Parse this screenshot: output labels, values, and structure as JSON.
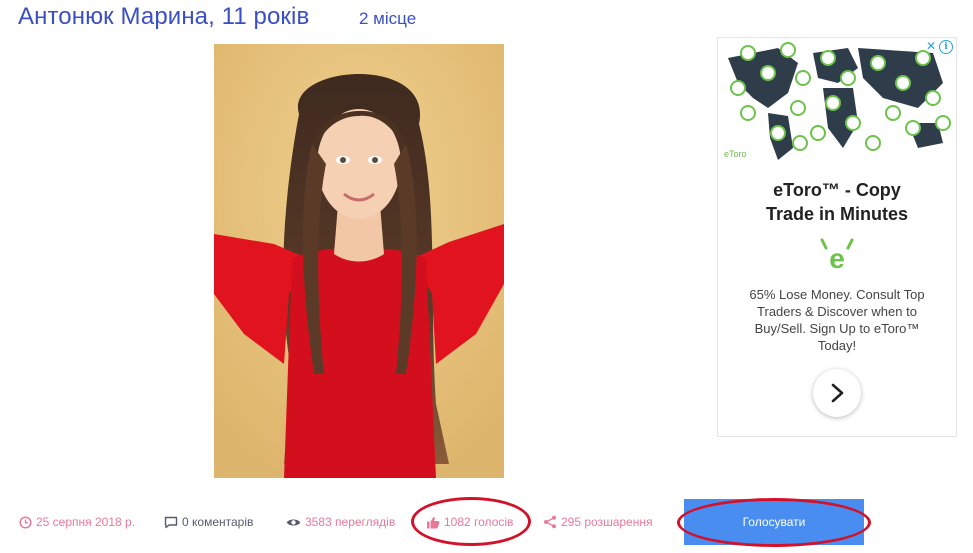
{
  "header": {
    "title": "Антонюк Марина, 11 років",
    "place": "2 місце"
  },
  "photo": {
    "subject": "girl-portrait-red-dress"
  },
  "ad": {
    "headline_line1": "eToro™ - Copy",
    "headline_line2": "Trade in Minutes",
    "body_line1": "65% Lose Money. Consult Top",
    "body_line2": "Traders & Discover when to",
    "body_line3": "Buy/Sell. Sign Up to eToro™",
    "body_line4": "Today!",
    "map_logo_text": "eToro",
    "brand_color": "#6cc24a"
  },
  "meta": {
    "date": "25 серпня 2018 р.",
    "comments": "0 коментарів",
    "views": "3583 переглядів",
    "votes": "1082 голосів",
    "shares": "295 розшарення"
  },
  "vote_button": {
    "label": "Голосувати"
  },
  "colors": {
    "title": "#3b4fc4",
    "meta": "#e9799b",
    "button": "#4a8df1",
    "annotation": "#d3122a"
  }
}
